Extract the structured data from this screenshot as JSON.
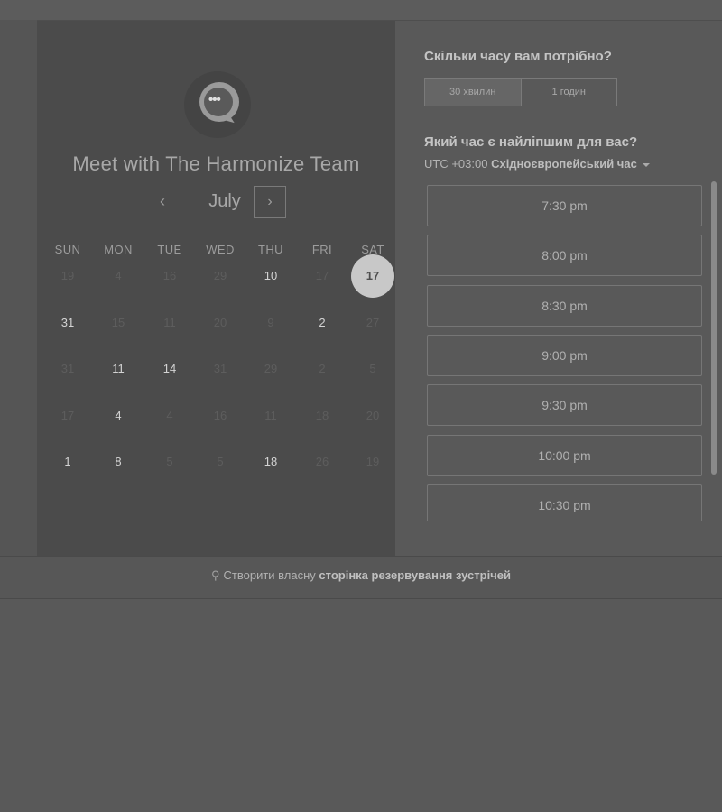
{
  "calendar": {
    "title": "Meet with The Harmonize Team",
    "month": "July",
    "days_of_week": [
      "SUN",
      "MON",
      "TUE",
      "WED",
      "THU",
      "FRI",
      "SAT"
    ],
    "weeks": [
      [
        {
          "d": "19",
          "a": false
        },
        {
          "d": "4",
          "a": false
        },
        {
          "d": "16",
          "a": false
        },
        {
          "d": "29",
          "a": false
        },
        {
          "d": "10",
          "a": true
        },
        {
          "d": "17",
          "a": false
        },
        {
          "d": "17",
          "a": true,
          "sel": true
        }
      ],
      [
        {
          "d": "31",
          "a": true
        },
        {
          "d": "15",
          "a": false
        },
        {
          "d": "11",
          "a": false
        },
        {
          "d": "20",
          "a": false
        },
        {
          "d": "9",
          "a": false
        },
        {
          "d": "2",
          "a": true
        },
        {
          "d": "27",
          "a": false
        }
      ],
      [
        {
          "d": "31",
          "a": false
        },
        {
          "d": "11",
          "a": true
        },
        {
          "d": "14",
          "a": true
        },
        {
          "d": "31",
          "a": false
        },
        {
          "d": "29",
          "a": false
        },
        {
          "d": "2",
          "a": false
        },
        {
          "d": "5",
          "a": false
        }
      ],
      [
        {
          "d": "17",
          "a": false
        },
        {
          "d": "4",
          "a": true
        },
        {
          "d": "4",
          "a": false
        },
        {
          "d": "16",
          "a": false
        },
        {
          "d": "11",
          "a": false
        },
        {
          "d": "18",
          "a": false
        },
        {
          "d": "20",
          "a": false
        }
      ],
      [
        {
          "d": "1",
          "a": true
        },
        {
          "d": "8",
          "a": true
        },
        {
          "d": "5",
          "a": false
        },
        {
          "d": "5",
          "a": false
        },
        {
          "d": "18",
          "a": true
        },
        {
          "d": "26",
          "a": false
        },
        {
          "d": "19",
          "a": false
        }
      ]
    ]
  },
  "booking": {
    "duration_question": "Скільки часу вам потрібно?",
    "durations": [
      "30 хвилин",
      "1 годин"
    ],
    "time_question": "Який час є найліпшим для вас?",
    "tz_offset": "UTC +03:00",
    "tz_name": "Східноєвропейський час",
    "slots": [
      "7:30 pm",
      "8:00 pm",
      "8:30 pm",
      "9:00 pm",
      "9:30 pm",
      "10:00 pm",
      "10:30 pm"
    ]
  },
  "footer": {
    "prefix": "Створити власну ",
    "link": "сторінка резервування зустрічей"
  }
}
